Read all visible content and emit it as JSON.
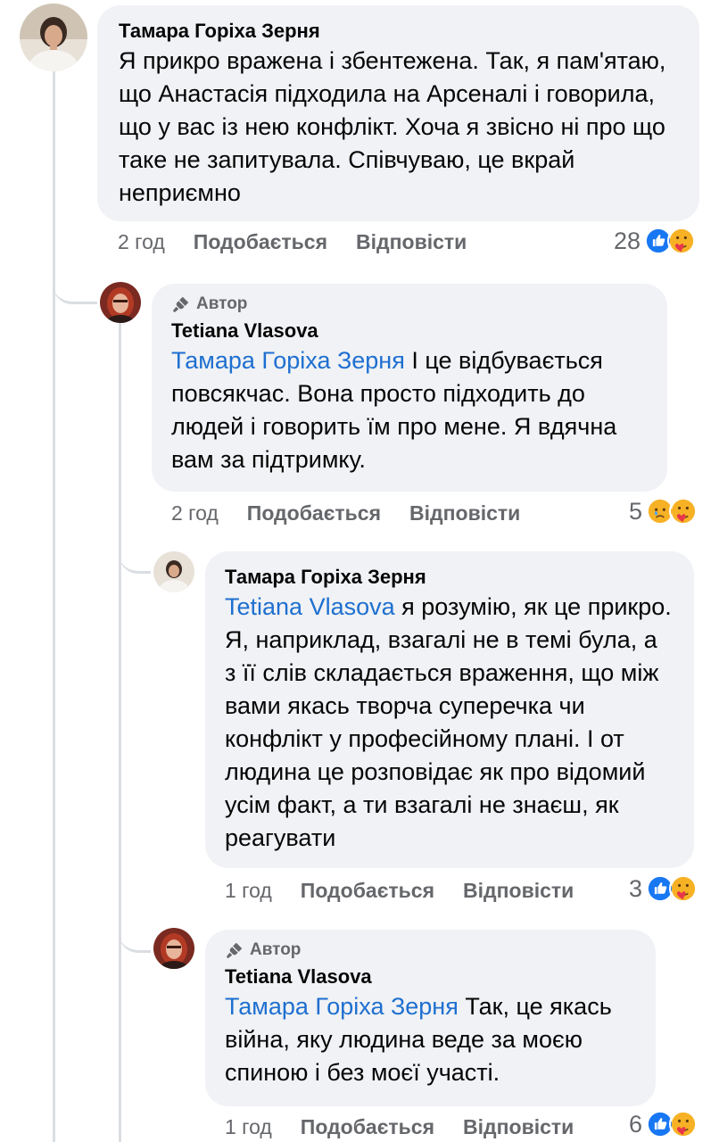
{
  "comments": [
    {
      "author": "Тамара Горіха Зерня",
      "author_badge": "",
      "mention": "",
      "text": "Я прикро вражена і збентежена. Так, я пам'ятаю, що Анастасія підходила на Арсеналі і говорила, що у вас із нею конфлікт. Хоча я звісно ні про що таке не запитувала. Співчуваю, це вкрай неприємно",
      "time": "2 год",
      "like_label": "Подобається",
      "reply_label": "Відповісти",
      "reaction_count": "28",
      "reactions": [
        "like-icon",
        "care-icon"
      ]
    },
    {
      "author": "Tetiana Vlasova",
      "author_badge": "Автор",
      "mention": "Тамара Горіха Зерня",
      "text": "І це відбувається повсякчас. Вона просто підходить до людей і говорить їм про мене. Я вдячна вам за підтримку.",
      "time": "2 год",
      "like_label": "Подобається",
      "reply_label": "Відповісти",
      "reaction_count": "5",
      "reactions": [
        "sad-icon",
        "care-icon"
      ]
    },
    {
      "author": "Тамара Горіха Зерня",
      "author_badge": "",
      "mention": "Tetiana Vlasova",
      "text": "я розумію, як це прикро. Я, наприклад, взагалі не в темі була, а з її слів складається враження, що між вами якась творча суперечка чи конфлікт у професійному плані. І от людина це розповідає як про відомий усім факт, а ти взагалі не знаєш, як реагувати",
      "time": "1 год",
      "like_label": "Подобається",
      "reply_label": "Відповісти",
      "reaction_count": "3",
      "reactions": [
        "like-icon",
        "care-icon"
      ]
    },
    {
      "author": "Tetiana Vlasova",
      "author_badge": "Автор",
      "mention": "Тамара Горіха Зерня",
      "text": "Так, це якась війна, яку людина веде за моєю спиною і без моєї участі.",
      "time": "1 год",
      "like_label": "Подобається",
      "reply_label": "Відповісти",
      "reaction_count": "6",
      "reactions": [
        "like-icon",
        "care-icon"
      ]
    }
  ],
  "colors": {
    "bubble": "#f0f2f5",
    "mention": "#1e6fd0",
    "meta": "#65676b",
    "like_blue": "#1877f2",
    "care_yellow": "#f7b125",
    "thread_line": "#dadde1"
  }
}
